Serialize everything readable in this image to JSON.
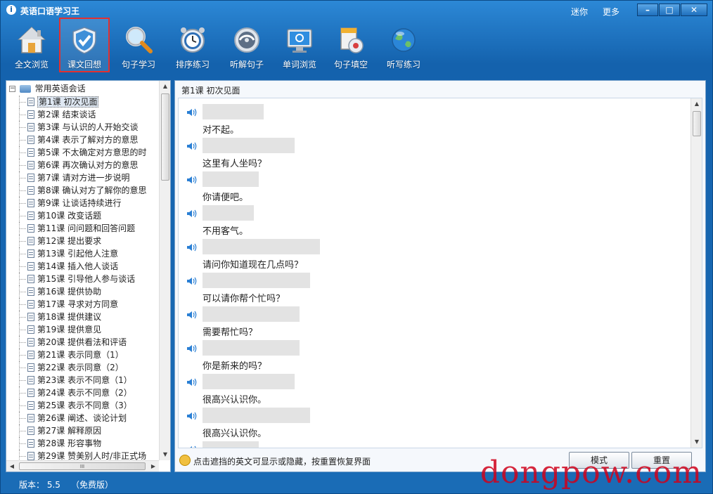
{
  "window": {
    "title": "英语口语学习王",
    "links": [
      "迷你",
      "更多"
    ],
    "controls": [
      "minimize",
      "maximize",
      "close"
    ]
  },
  "toolbar": {
    "items": [
      {
        "label": "全文浏览",
        "icon": "house-icon"
      },
      {
        "label": "课文回想",
        "icon": "shield-check-icon",
        "active": true
      },
      {
        "label": "句子学习",
        "icon": "magnifier-icon"
      },
      {
        "label": "排序练习",
        "icon": "alarm-clock-icon"
      },
      {
        "label": "听解句子",
        "icon": "disc-icon"
      },
      {
        "label": "单词浏览",
        "icon": "monitor-icon"
      },
      {
        "label": "句子填空",
        "icon": "document-disc-icon"
      },
      {
        "label": "听写练习",
        "icon": "globe-icon"
      }
    ]
  },
  "tree": {
    "root": "常用英语会话",
    "items": [
      "第1课 初次见面",
      "第2课 结束谈话",
      "第3课 与认识的人开始交谈",
      "第4课 表示了解对方的意思",
      "第5课 不太确定对方意思的时",
      "第6课 再次确认对方的意思",
      "第7课 请对方进一步说明",
      "第8课 确认对方了解你的意思",
      "第9课 让谈话持续进行",
      "第10课 改变话题",
      "第11课 问问题和回答问题",
      "第12课 提出要求",
      "第13课 引起他人注意",
      "第14课 插入他人谈话",
      "第15课 引导他人参与谈话",
      "第16课 提供协助",
      "第17课 寻求对方同意",
      "第18课 提供建议",
      "第19课 提供意见",
      "第20课 提供看法和评语",
      "第21课 表示同意（1）",
      "第22课 表示同意（2）",
      "第23课 表示不同意（1）",
      "第24课 表示不同意（2）",
      "第25课 表示不同意（3）",
      "第26课 阐述、谈论计划",
      "第27课 解释原因",
      "第28课 形容事物",
      "第29课 赞美别人时/非正式场"
    ],
    "selected_index": 0,
    "hscroll_label": "III"
  },
  "lesson": {
    "title": "第1课 初次见面",
    "sentences": [
      {
        "zh": "对不起。",
        "mask_fraction": 0.12
      },
      {
        "zh": "这里有人坐吗？",
        "mask_fraction": 0.18
      },
      {
        "zh": "你请便吧。",
        "mask_fraction": 0.11
      },
      {
        "zh": "不用客气。",
        "mask_fraction": 0.1
      },
      {
        "zh": "请问你知道现在几点吗？",
        "mask_fraction": 0.23
      },
      {
        "zh": "可以请你帮个忙吗？",
        "mask_fraction": 0.21
      },
      {
        "zh": "需要帮忙吗？",
        "mask_fraction": 0.19
      },
      {
        "zh": "你是新来的吗？",
        "mask_fraction": 0.19
      },
      {
        "zh": "很高兴认识你。",
        "mask_fraction": 0.18
      },
      {
        "zh": "很高兴认识你。",
        "mask_fraction": 0.21
      },
      {
        "zh": "",
        "mask_fraction": 0.11
      }
    ]
  },
  "footer": {
    "hint": "点击遮挡的英文可显示或隐藏，按重置恢复界面",
    "mode_button": "模式",
    "reset_button": "重置"
  },
  "status": {
    "version": "版本： 5.5",
    "edition": "（免费版）"
  },
  "watermark": "dongpow.com",
  "colors": {
    "frame": "#1a6cb6",
    "active_border": "#e23030",
    "mask": "#e3e3e3",
    "speaker": "#2a7fd4"
  }
}
